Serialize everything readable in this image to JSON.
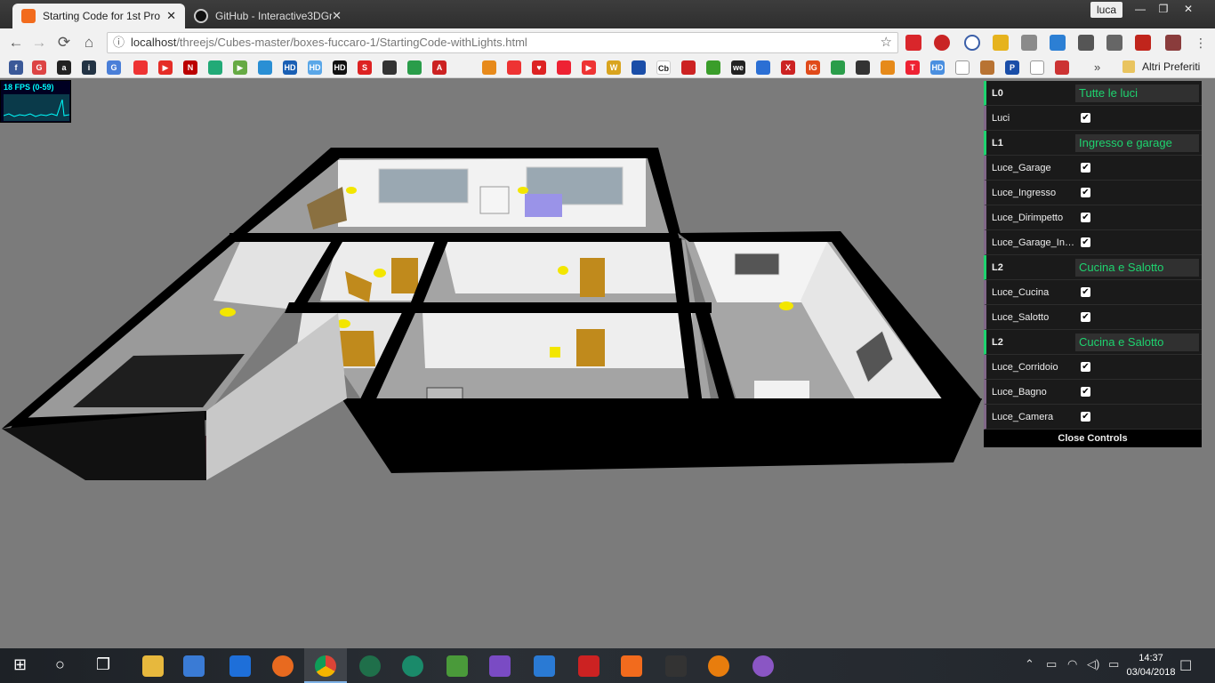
{
  "browser": {
    "tabs": [
      {
        "title": "Starting Code for 1st Pro",
        "active": true,
        "close": "✕"
      },
      {
        "title": "GitHub - Interactive3DGr",
        "active": false,
        "close": "✕"
      }
    ],
    "profile_name": "luca",
    "window_controls": {
      "minimize": "—",
      "maximize": "❐",
      "close": "✕"
    },
    "nav": {
      "back": "←",
      "forward": "→",
      "reload": "⟳",
      "home": "⌂"
    },
    "url_host": "localhost",
    "url_path": "/threejs/Cubes-master/boxes-fuccaro-1/StartingCode-withLights.html",
    "info_icon": "ⓘ",
    "bookmark_star": "☆",
    "bookmarks_more": "»",
    "other_bookmarks": "Altri Preferiti"
  },
  "stats": {
    "fps_label": "18 FPS (0-59)",
    "fps_value": 18,
    "fps_min": 0,
    "fps_max": 59
  },
  "gui": {
    "folders": [
      {
        "name": "L0",
        "title": "Tutte le luci",
        "controls": [
          {
            "label": "Luci",
            "checked": true
          }
        ]
      },
      {
        "name": "L1",
        "title": "Ingresso e garage",
        "controls": [
          {
            "label": "Luce_Garage",
            "checked": true
          },
          {
            "label": "Luce_Ingresso",
            "checked": true
          },
          {
            "label": "Luce_Dirimpetto",
            "checked": true
          },
          {
            "label": "Luce_Garage_In…",
            "checked": true
          }
        ]
      },
      {
        "name": "L2",
        "title": "Cucina e Salotto",
        "controls": [
          {
            "label": "Luce_Cucina",
            "checked": true
          },
          {
            "label": "Luce_Salotto",
            "checked": true
          }
        ]
      },
      {
        "name": "L2",
        "title": "Cucina e Salotto",
        "controls": [
          {
            "label": "Luce_Corridoio",
            "checked": true
          },
          {
            "label": "Luce_Bagno",
            "checked": true
          },
          {
            "label": "Luce_Camera",
            "checked": true
          }
        ]
      }
    ],
    "close_label": "Close Controls",
    "checkmark": "✔"
  },
  "taskbar": {
    "start_icon": "windows-start-icon",
    "clock_time": "14:37",
    "clock_date": "03/04/2018"
  },
  "colors": {
    "gui_accent": "#1ed36f",
    "wall": "#000000",
    "floor": "#a8a8a8",
    "light": "#f3e600",
    "door": "#c08a1c"
  }
}
